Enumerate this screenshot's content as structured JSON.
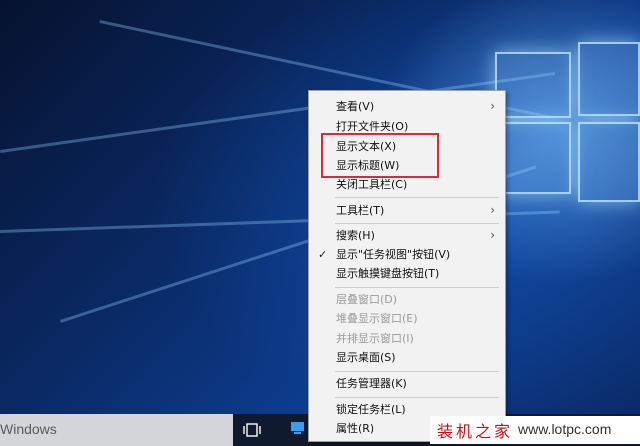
{
  "taskbar": {
    "search_text": "Windows"
  },
  "context_menu": {
    "items": [
      {
        "label": "查看(V)",
        "submenu": true,
        "enabled": true
      },
      {
        "label": "打开文件夹(O)",
        "enabled": true
      },
      {
        "label": "显示文本(X)",
        "enabled": true
      },
      {
        "label": "显示标题(W)",
        "enabled": true
      },
      {
        "label": "关闭工具栏(C)",
        "enabled": true
      },
      {
        "label": "工具栏(T)",
        "submenu": true,
        "enabled": true
      },
      {
        "label": "搜索(H)",
        "submenu": true,
        "enabled": true
      },
      {
        "label": "显示\"任务视图\"按钮(V)",
        "checked": true,
        "enabled": true
      },
      {
        "label": "显示触摸键盘按钮(T)",
        "enabled": true
      },
      {
        "label": "层叠窗口(D)",
        "enabled": false
      },
      {
        "label": "堆叠显示窗口(E)",
        "enabled": false
      },
      {
        "label": "并排显示窗口(I)",
        "enabled": false
      },
      {
        "label": "显示桌面(S)",
        "enabled": true
      },
      {
        "label": "任务管理器(K)",
        "enabled": true
      },
      {
        "label": "锁定任务栏(L)",
        "enabled": true
      },
      {
        "label": "属性(R)",
        "enabled": true
      }
    ],
    "arrow_glyph": "›",
    "check_glyph": "✓"
  },
  "watermark": {
    "brand": "装机之家",
    "url": "www.lotpc.com"
  },
  "colors": {
    "highlight_border": "#e0263a",
    "menu_background": "#f2f2f2"
  }
}
